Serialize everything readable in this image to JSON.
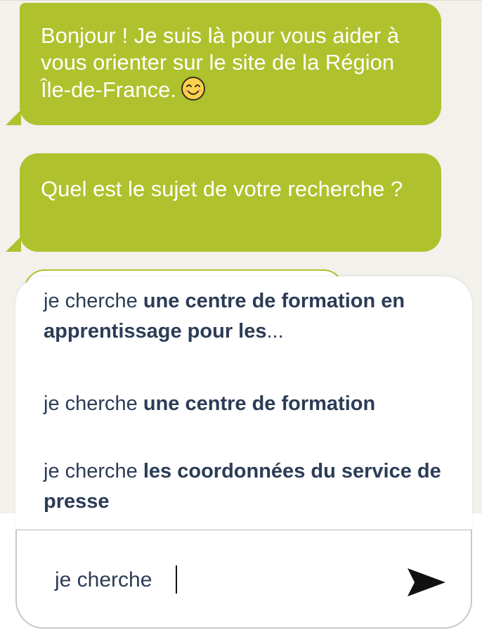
{
  "chat": {
    "messages": [
      {
        "text": "Bonjour ! Je suis là pour vous aider à vous orienter sur le site de la Région Île-de-France."
      },
      {
        "text": "Quel est le sujet de votre recherche ?"
      }
    ]
  },
  "suggestions": [
    {
      "prefix": "je cherche ",
      "strong": "une centre de formation en apprentissage pour les",
      "ellipsis": "..."
    },
    {
      "prefix": "je cherche ",
      "strong": "une centre de formation",
      "ellipsis": ""
    },
    {
      "prefix": "je cherche ",
      "strong": "les coordonnées du service de presse",
      "ellipsis": ""
    }
  ],
  "input": {
    "value": "je cherche "
  },
  "icons": {
    "emoji": "smiling-face-emoji",
    "send": "send-arrow-icon"
  },
  "colors": {
    "bubble": "#afc12d",
    "text_dark": "#2b3c55",
    "background": "#f2f1ec"
  }
}
